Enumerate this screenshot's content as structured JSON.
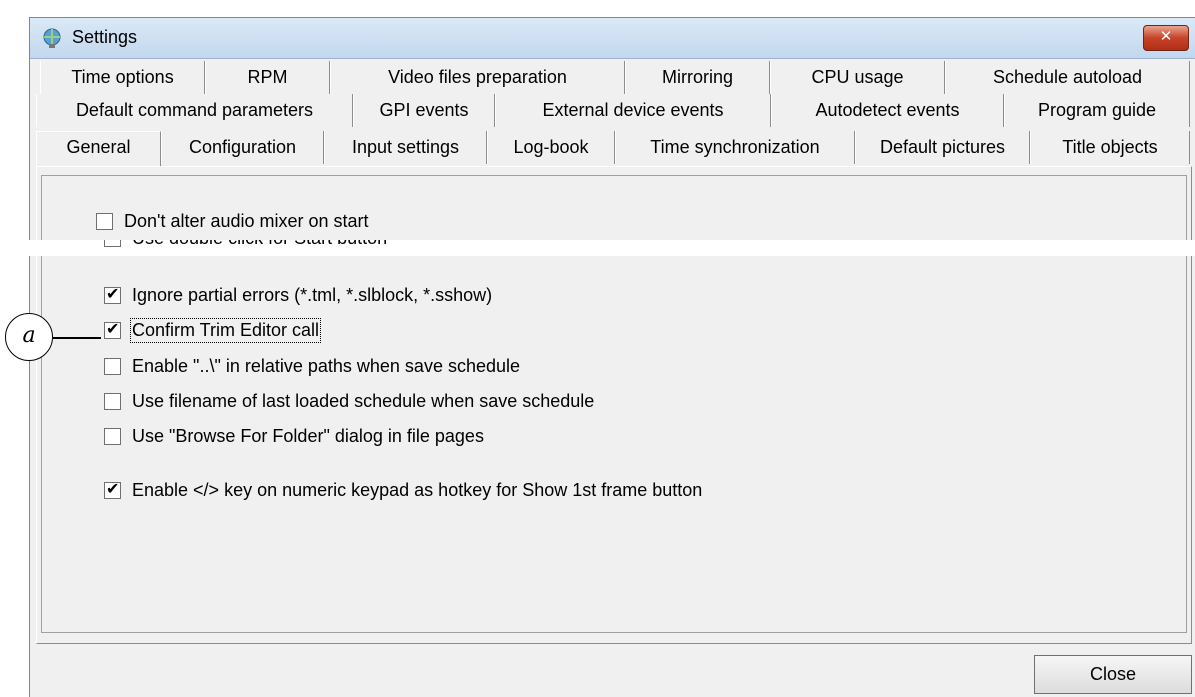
{
  "window": {
    "title": "Settings",
    "icons": {
      "app": "globe-gear-icon",
      "close": "close-icon"
    },
    "colors": {
      "close_button": "#c7432a",
      "titlebar": "#c2d7ee"
    }
  },
  "tabs": {
    "row1": [
      "Time options",
      "RPM",
      "Video files preparation",
      "Mirroring",
      "CPU usage",
      "Schedule autoload"
    ],
    "row2": [
      "Default command parameters",
      "GPI events",
      "External device events",
      "Autodetect events",
      "Program guide"
    ],
    "row3": [
      "General",
      "Configuration",
      "Input settings",
      "Log-book",
      "Time synchronization",
      "Default pictures",
      "Title objects"
    ],
    "active": "General"
  },
  "options": [
    {
      "label": "Don't alter audio mixer on start",
      "checked": false
    },
    {
      "label": "Use double click for Start button",
      "checked": false
    },
    {
      "label": "Ignore partial errors (*.tml, *.slblock, *.sshow)",
      "checked": true
    },
    {
      "label": "Confirm Trim Editor call",
      "checked": true
    },
    {
      "label": "Enable \"..\\\" in relative paths when save schedule",
      "checked": false
    },
    {
      "label": "Use filename of last loaded schedule when save schedule",
      "checked": false
    },
    {
      "label": "Use \"Browse For Folder\" dialog in file pages",
      "checked": false
    },
    {
      "label": "Enable </> key on numeric keypad as hotkey for Show 1st frame button",
      "checked": true
    }
  ],
  "buttons": {
    "close": "Close"
  },
  "callout": {
    "label": "a"
  }
}
